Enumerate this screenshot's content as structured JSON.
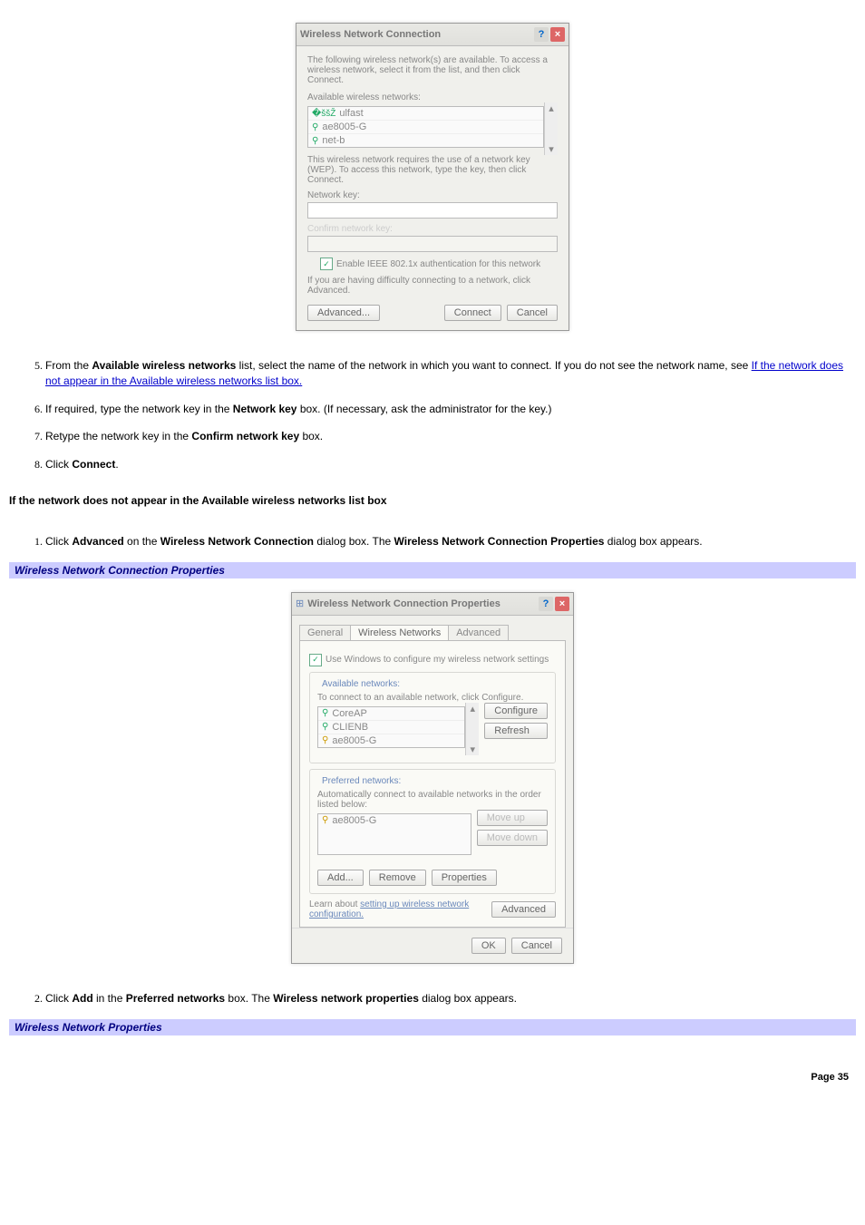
{
  "dialog1": {
    "title": "Wireless Network Connection",
    "intro": "The following wireless network(s) are available. To access a wireless network, select it from the list, and then click Connect.",
    "available_label": "Available wireless networks:",
    "networks": [
      "ulfast",
      "ae8005-G",
      "net-b"
    ],
    "wep_note": "This wireless network requires the use of a network key (WEP). To access this network, type the key, then click Connect.",
    "netkey_label": "Network key:",
    "confirm_label": "Confirm network key:",
    "enable_8021x": "Enable IEEE 802.1x authentication for this network",
    "difficulty": "If you are having difficulty connecting to a network, click Advanced.",
    "btn_advanced": "Advanced...",
    "btn_connect": "Connect",
    "btn_cancel": "Cancel"
  },
  "steps_a": {
    "s5a": "From the ",
    "s5b": "Available wireless networks",
    "s5c": " list, select the name of the network in which you want to connect. If you do not see the network name, see ",
    "s5link": "If the network does not appear in the Available wireless networks list box.",
    "s6a": "If required, type the network key in the ",
    "s6b": "Network key",
    "s6c": " box. (If necessary, ask the administrator for the key.)",
    "s7a": "Retype the network key in the ",
    "s7b": "Confirm network key",
    "s7c": " box.",
    "s8a": "Click ",
    "s8b": "Connect",
    "s8c": "."
  },
  "subheading": "If the network does not appear in the Available wireless networks list box",
  "step_b1": {
    "a": "Click ",
    "b": "Advanced",
    "c": " on the ",
    "d": "Wireless Network Connection",
    "e": " dialog box. The ",
    "f": "Wireless Network Connection Properties",
    "g": " dialog box appears."
  },
  "band1": "Wireless Network Connection Properties",
  "dialog2": {
    "title": "Wireless Network Connection Properties",
    "tabs": [
      "General",
      "Wireless Networks",
      "Advanced"
    ],
    "use_windows": "Use Windows to configure my wireless network settings",
    "avail_legend": "Available networks:",
    "avail_desc": "To connect to an available network, click Configure.",
    "avail_items": [
      "CoreAP",
      "CLIENB",
      "ae8005-G"
    ],
    "btn_configure": "Configure",
    "btn_refresh": "Refresh",
    "pref_legend": "Preferred networks:",
    "pref_desc": "Automatically connect to available networks in the order listed below:",
    "pref_items": [
      "ae8005-G"
    ],
    "btn_moveup": "Move up",
    "btn_movedown": "Move down",
    "btn_add": "Add...",
    "btn_remove": "Remove",
    "btn_properties": "Properties",
    "learn_a": "Learn about ",
    "learn_b": "setting up wireless network configuration.",
    "btn_advanced": "Advanced",
    "btn_ok": "OK",
    "btn_cancel": "Cancel"
  },
  "step_b2": {
    "a": "Click ",
    "b": "Add",
    "c": " in the ",
    "d": "Preferred networks",
    "e": " box. The ",
    "f": "Wireless network properties",
    "g": " dialog box appears."
  },
  "band2": "Wireless Network Properties",
  "page_number": "Page 35"
}
